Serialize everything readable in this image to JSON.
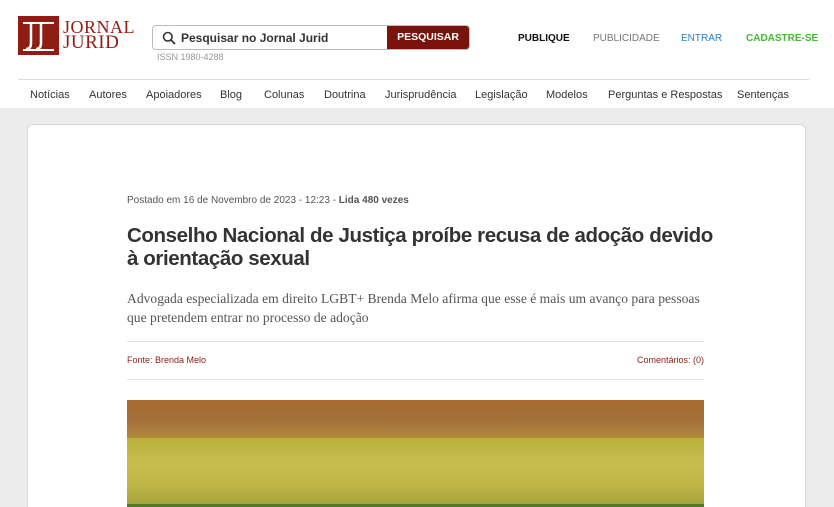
{
  "brand": {
    "logo_text_line1": "JORNAL",
    "logo_text_line2": "JURID",
    "accent": "#8f1d13"
  },
  "search": {
    "placeholder": "Pesquisar no Jornal Jurid",
    "button_label": "PESQUISAR",
    "issn": "ISSN 1980-4288"
  },
  "top_links": {
    "publique": "PUBLIQUE",
    "publicidade": "PUBLICIDADE",
    "entrar": "ENTRAR",
    "cadastre": "CADASTRE-SE",
    "entrar_color": "#2a7fc1",
    "cadastre_color": "#3fbd2a"
  },
  "nav": {
    "items": [
      "Notícias",
      "Autores",
      "Apoiadores",
      "Blog",
      "Colunas",
      "Doutrina",
      "Jurisprudência",
      "Legislação",
      "Modelos",
      "Perguntas e Respostas",
      "Sentenças"
    ]
  },
  "article": {
    "meta_prefix": "Postado em 16 de Novembro de 2023 - 12:23 - ",
    "meta_reads": "Lida 480 vezes",
    "title": "Conselho Nacional de Justiça proíbe recusa de adoção devido à orientação sexual",
    "subtitle": "Advogada especializada em direito LGBT+ Brenda Melo afirma que esse é mais um avanço para pessoas que pretendem entrar no processo de adoção",
    "source": "Fonte: Brenda Melo",
    "comments": "Comentários: (0)"
  }
}
